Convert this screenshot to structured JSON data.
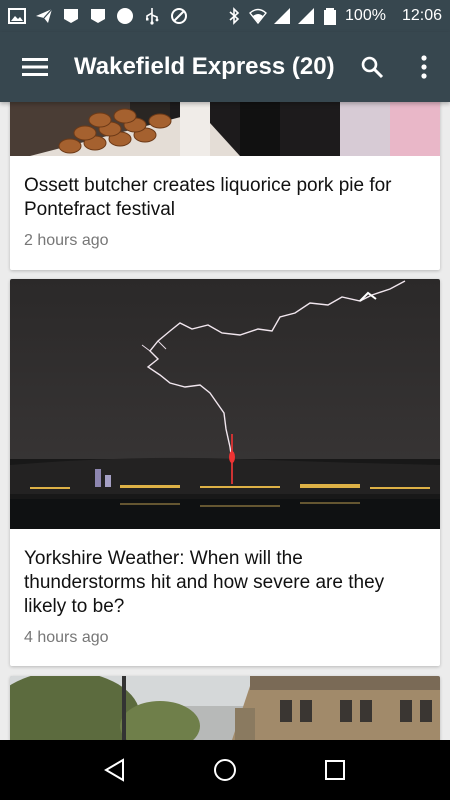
{
  "status_bar": {
    "battery_percent": "100%",
    "time": "12:06",
    "left_icons": [
      "image-icon",
      "send-icon",
      "notification-icon",
      "notification-icon",
      "circle-icon",
      "usb-icon",
      "blocked-icon"
    ],
    "right_icons": [
      "bluetooth-icon",
      "wifi-icon",
      "signal-icon",
      "signal-icon",
      "battery-icon"
    ]
  },
  "app_bar": {
    "title": "Wakefield Express (20)",
    "menu_icon": "menu-icon",
    "search_icon": "search-icon",
    "overflow_icon": "more-vert-icon"
  },
  "articles": [
    {
      "title": "Ossett butcher creates liquorice pork pie for Pontefract festival",
      "time": "2 hours ago",
      "image": "pork-pies-photo"
    },
    {
      "title": "Yorkshire Weather: When will the thunderstorms hit and how severe are they likely to be?",
      "time": "4 hours ago",
      "image": "lightning-over-harbour-photo"
    },
    {
      "title": "",
      "time": "",
      "image": "street-buildings-photo"
    }
  ],
  "nav_bar": {
    "back_icon": "back-icon",
    "home_icon": "home-icon",
    "recents_icon": "recents-icon"
  },
  "colors": {
    "primary": "#37474f",
    "background": "#ececec",
    "card": "#ffffff",
    "muted_text": "#777777"
  }
}
